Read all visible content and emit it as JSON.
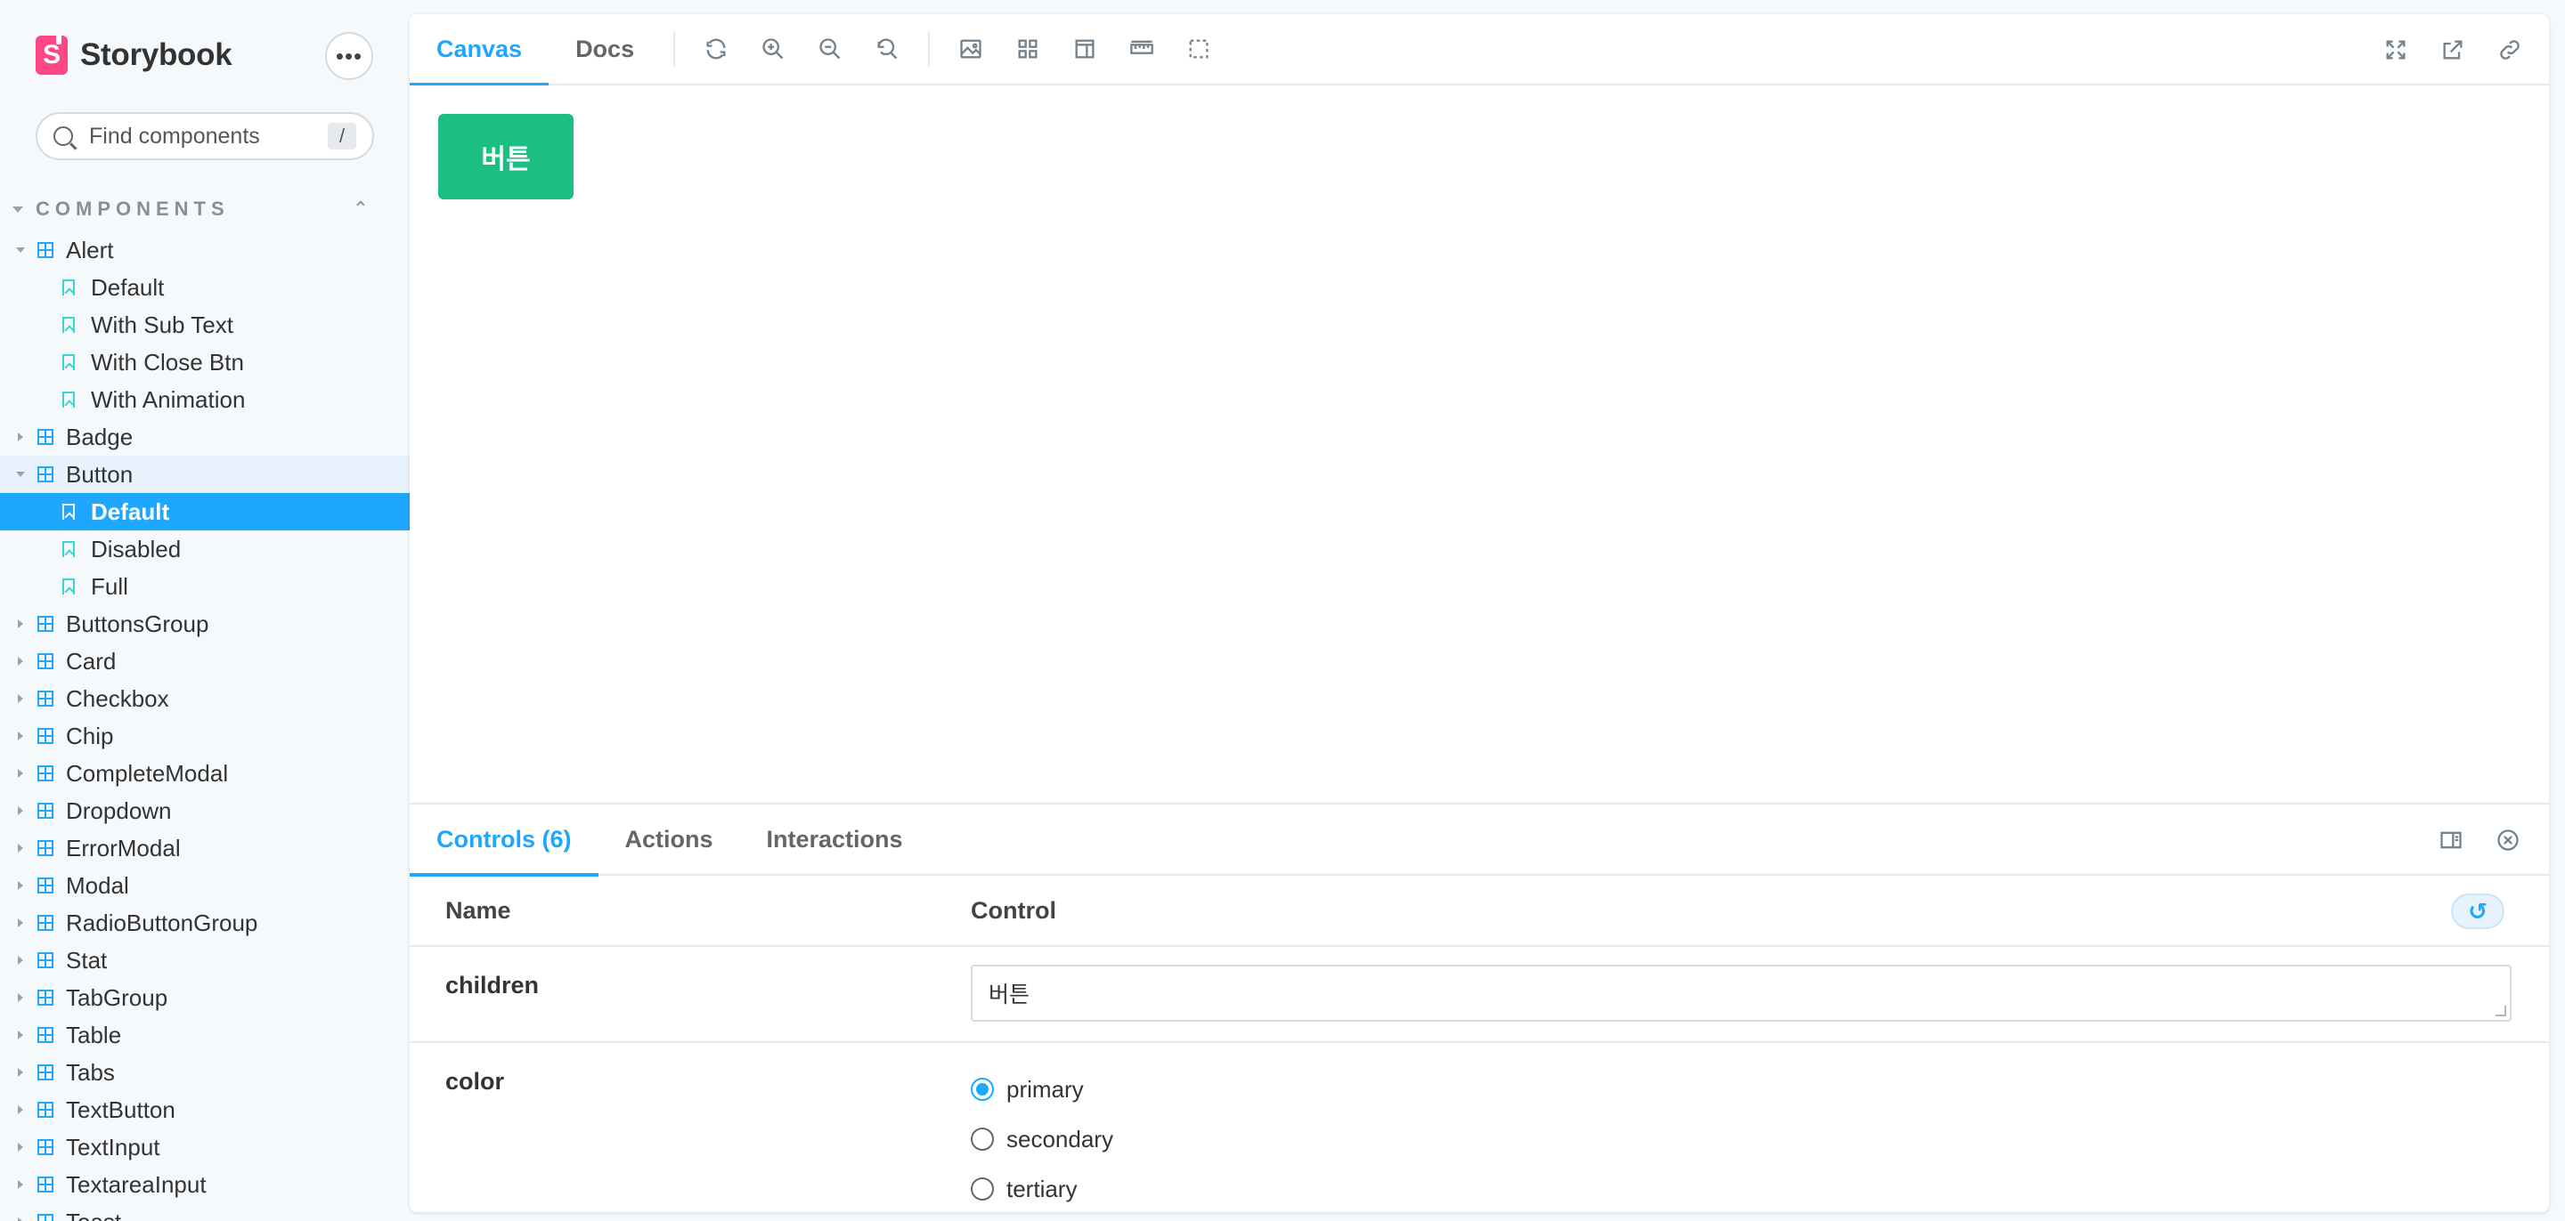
{
  "sidebar": {
    "brand": "Storybook",
    "brand_logo_letter": "S",
    "menu_icon": "more-horizontal-icon",
    "search": {
      "placeholder": "Find components",
      "shortcut": "/"
    },
    "section_title": "COMPONENTS",
    "tree": [
      {
        "type": "component",
        "label": "Alert",
        "expanded": true
      },
      {
        "type": "story",
        "label": "Default"
      },
      {
        "type": "story",
        "label": "With Sub Text"
      },
      {
        "type": "story",
        "label": "With Close Btn"
      },
      {
        "type": "story",
        "label": "With Animation"
      },
      {
        "type": "component",
        "label": "Badge",
        "expanded": false
      },
      {
        "type": "component",
        "label": "Button",
        "expanded": true,
        "active_parent": true
      },
      {
        "type": "story",
        "label": "Default",
        "selected": true
      },
      {
        "type": "story",
        "label": "Disabled"
      },
      {
        "type": "story",
        "label": "Full"
      },
      {
        "type": "component",
        "label": "ButtonsGroup",
        "expanded": false
      },
      {
        "type": "component",
        "label": "Card",
        "expanded": false
      },
      {
        "type": "component",
        "label": "Checkbox",
        "expanded": false
      },
      {
        "type": "component",
        "label": "Chip",
        "expanded": false
      },
      {
        "type": "component",
        "label": "CompleteModal",
        "expanded": false
      },
      {
        "type": "component",
        "label": "Dropdown",
        "expanded": false
      },
      {
        "type": "component",
        "label": "ErrorModal",
        "expanded": false
      },
      {
        "type": "component",
        "label": "Modal",
        "expanded": false
      },
      {
        "type": "component",
        "label": "RadioButtonGroup",
        "expanded": false
      },
      {
        "type": "component",
        "label": "Stat",
        "expanded": false
      },
      {
        "type": "component",
        "label": "TabGroup",
        "expanded": false
      },
      {
        "type": "component",
        "label": "Table",
        "expanded": false
      },
      {
        "type": "component",
        "label": "Tabs",
        "expanded": false
      },
      {
        "type": "component",
        "label": "TextButton",
        "expanded": false
      },
      {
        "type": "component",
        "label": "TextInput",
        "expanded": false
      },
      {
        "type": "component",
        "label": "TextareaInput",
        "expanded": false
      },
      {
        "type": "component",
        "label": "Toast",
        "expanded": false
      }
    ]
  },
  "toolbar": {
    "tabs": [
      {
        "label": "Canvas",
        "active": true
      },
      {
        "label": "Docs",
        "active": false
      }
    ],
    "tools": [
      "reload-icon",
      "zoom-in-icon",
      "zoom-out-icon",
      "zoom-reset-icon",
      "background-icon",
      "grid-icon",
      "viewport-icon",
      "measure-icon",
      "outline-icon"
    ],
    "right_tools": [
      "fullscreen-icon",
      "open-new-tab-icon",
      "copy-link-icon"
    ]
  },
  "canvas": {
    "button_label": "버튼",
    "button_color": "#1bbf83"
  },
  "addons": {
    "tabs": [
      {
        "label": "Controls (6)",
        "active": true
      },
      {
        "label": "Actions",
        "active": false
      },
      {
        "label": "Interactions",
        "active": false
      }
    ],
    "actions": [
      "panel-orientation-icon",
      "close-panel-icon"
    ],
    "table": {
      "name_header": "Name",
      "control_header": "Control",
      "rows": [
        {
          "name": "children",
          "control": "text",
          "value": "버튼"
        },
        {
          "name": "color",
          "control": "radio",
          "options": [
            "primary",
            "secondary",
            "tertiary"
          ],
          "selected": "primary"
        }
      ]
    }
  },
  "colors": {
    "accent": "#1ea7fd",
    "brand": "#ff4785",
    "story": "#37d5d3"
  }
}
